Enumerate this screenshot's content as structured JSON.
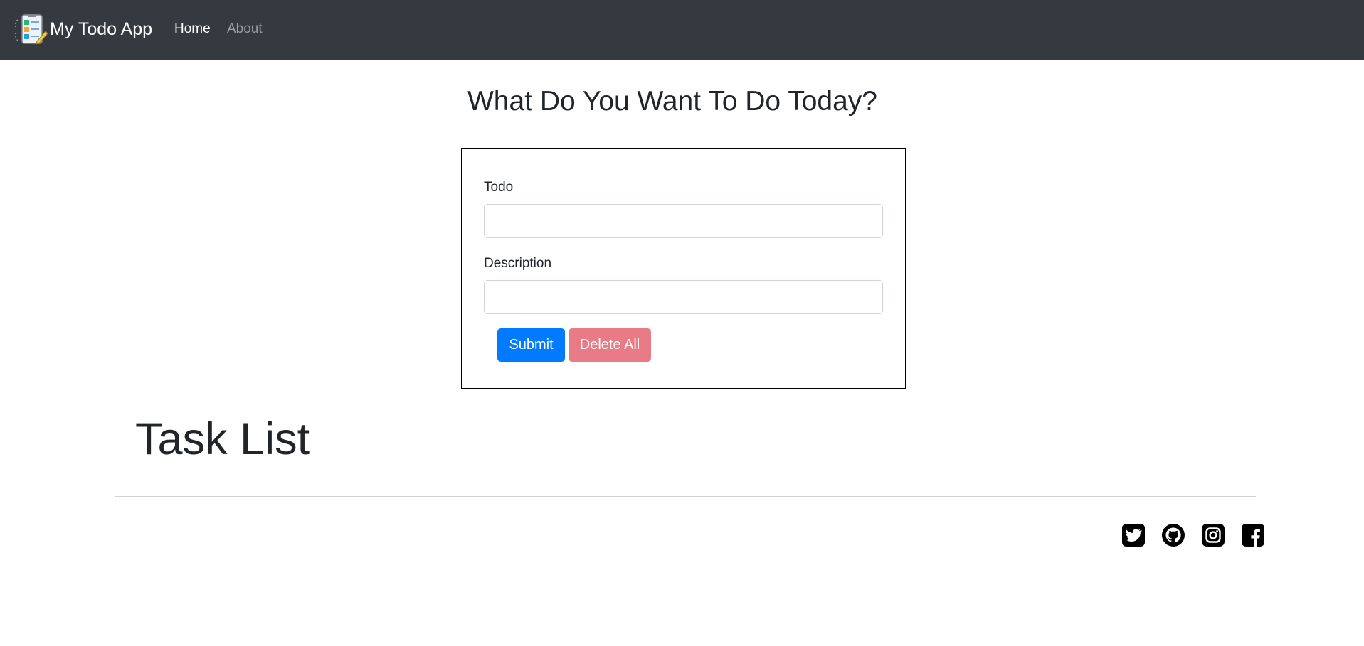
{
  "navbar": {
    "brand": "My Todo App",
    "links": [
      {
        "label": "Home",
        "active": true
      },
      {
        "label": "About",
        "active": false
      }
    ]
  },
  "main": {
    "heading": "What Do You Want To Do Today?",
    "form": {
      "todo_label": "Todo",
      "todo_value": "",
      "description_label": "Description",
      "description_value": "",
      "submit_label": "Submit",
      "delete_all_label": "Delete All"
    },
    "task_list_title": "Task List"
  },
  "footer": {
    "social": [
      {
        "icon": "twitter-icon"
      },
      {
        "icon": "github-icon"
      },
      {
        "icon": "instagram-icon"
      },
      {
        "icon": "facebook-icon"
      }
    ]
  },
  "colors": {
    "navbar_bg": "#343a40",
    "primary": "#007bff",
    "danger": "#dc3545",
    "text": "#212529"
  }
}
